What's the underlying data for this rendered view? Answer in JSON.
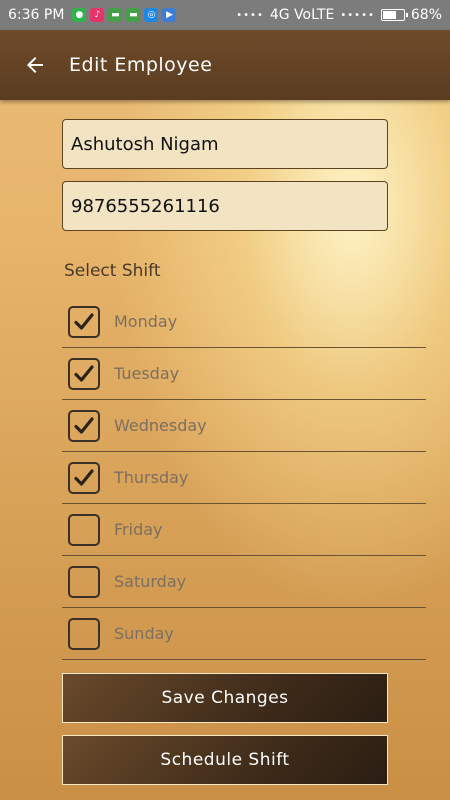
{
  "status_bar": {
    "time": "6:36 PM",
    "network": "4G VoLTE",
    "battery": "68%",
    "battery_level": 0.68
  },
  "app_bar": {
    "title": "Edit Employee",
    "back_icon": "arrow-left-icon"
  },
  "form": {
    "name_value": "Ashutosh Nigam",
    "phone_value": "9876555261116",
    "select_shift_label": "Select Shift"
  },
  "shifts": [
    {
      "day": "Monday",
      "checked": true
    },
    {
      "day": "Tuesday",
      "checked": true
    },
    {
      "day": "Wednesday",
      "checked": true
    },
    {
      "day": "Thursday",
      "checked": true
    },
    {
      "day": "Friday",
      "checked": false
    },
    {
      "day": "Saturday",
      "checked": false
    },
    {
      "day": "Sunday",
      "checked": false
    }
  ],
  "buttons": {
    "save_label": "Save Changes",
    "schedule_label": "Schedule Shift"
  },
  "colors": {
    "app_bar": "#6e4b2a",
    "background": "#e7b46b",
    "button": "#4a3320"
  }
}
